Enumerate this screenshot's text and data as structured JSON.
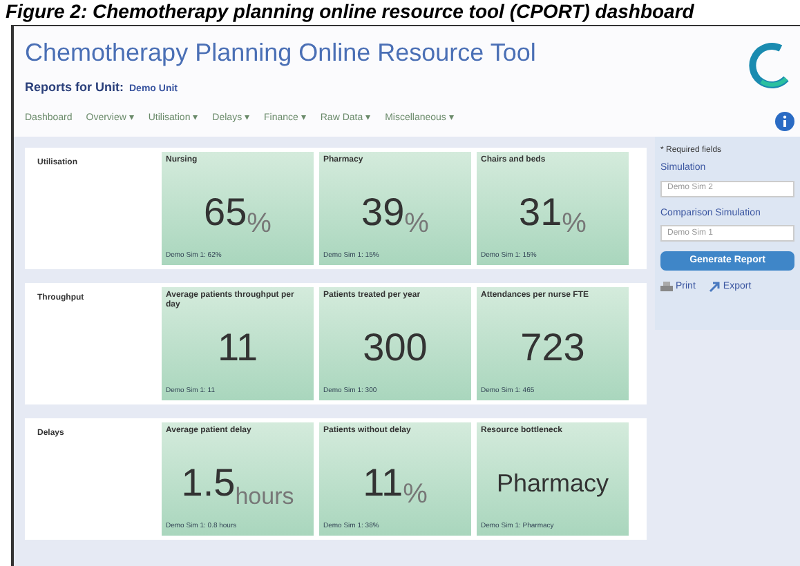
{
  "caption": "Figure 2: Chemotherapy planning online resource tool (CPORT) dashboard",
  "app_title": "Chemotherapy Planning Online Resource Tool",
  "reports_label": "Reports for Unit:",
  "unit": "Demo Unit",
  "menu": [
    "Dashboard",
    "Overview ▾",
    "Utilisation ▾",
    "Delays ▾",
    "Finance ▾",
    "Raw Data ▾",
    "Miscellaneous ▾"
  ],
  "sections": [
    {
      "title": "Utilisation",
      "cards": [
        {
          "label": "Nursing",
          "value": "65",
          "unit": "%",
          "note": "Demo Sim 1: 62%"
        },
        {
          "label": "Pharmacy",
          "value": "39",
          "unit": "%",
          "note": "Demo Sim 1: 15%"
        },
        {
          "label": "Chairs and beds",
          "value": "31",
          "unit": "%",
          "note": "Demo Sim 1: 15%"
        }
      ]
    },
    {
      "title": "Throughput",
      "cards": [
        {
          "label": "Average patients throughput per day",
          "value": "11",
          "note": "Demo Sim 1: 11"
        },
        {
          "label": "Patients treated per year",
          "value": "300",
          "note": "Demo Sim 1: 300"
        },
        {
          "label": "Attendances per nurse FTE",
          "value": "723",
          "note": "Demo Sim 1: 465"
        }
      ]
    },
    {
      "title": "Delays",
      "cards": [
        {
          "label": "Average patient delay",
          "value": "1.5",
          "unit": "hours",
          "note": "Demo Sim 1: 0.8 hours"
        },
        {
          "label": "Patients without delay",
          "value": "11",
          "unit": "%",
          "note": "Demo Sim 1: 38%"
        },
        {
          "label": "Resource bottleneck",
          "value": "Pharmacy",
          "note": "Demo Sim 1: Pharmacy"
        }
      ]
    }
  ],
  "sidebar": {
    "required_note": "* Required fields",
    "simulation_label": "Simulation",
    "simulation_value": "Demo Sim 2",
    "comparison_label": "Comparison Simulation",
    "comparison_value": "Demo Sim 1",
    "generate": "Generate Report",
    "print": "Print",
    "export": "Export"
  }
}
